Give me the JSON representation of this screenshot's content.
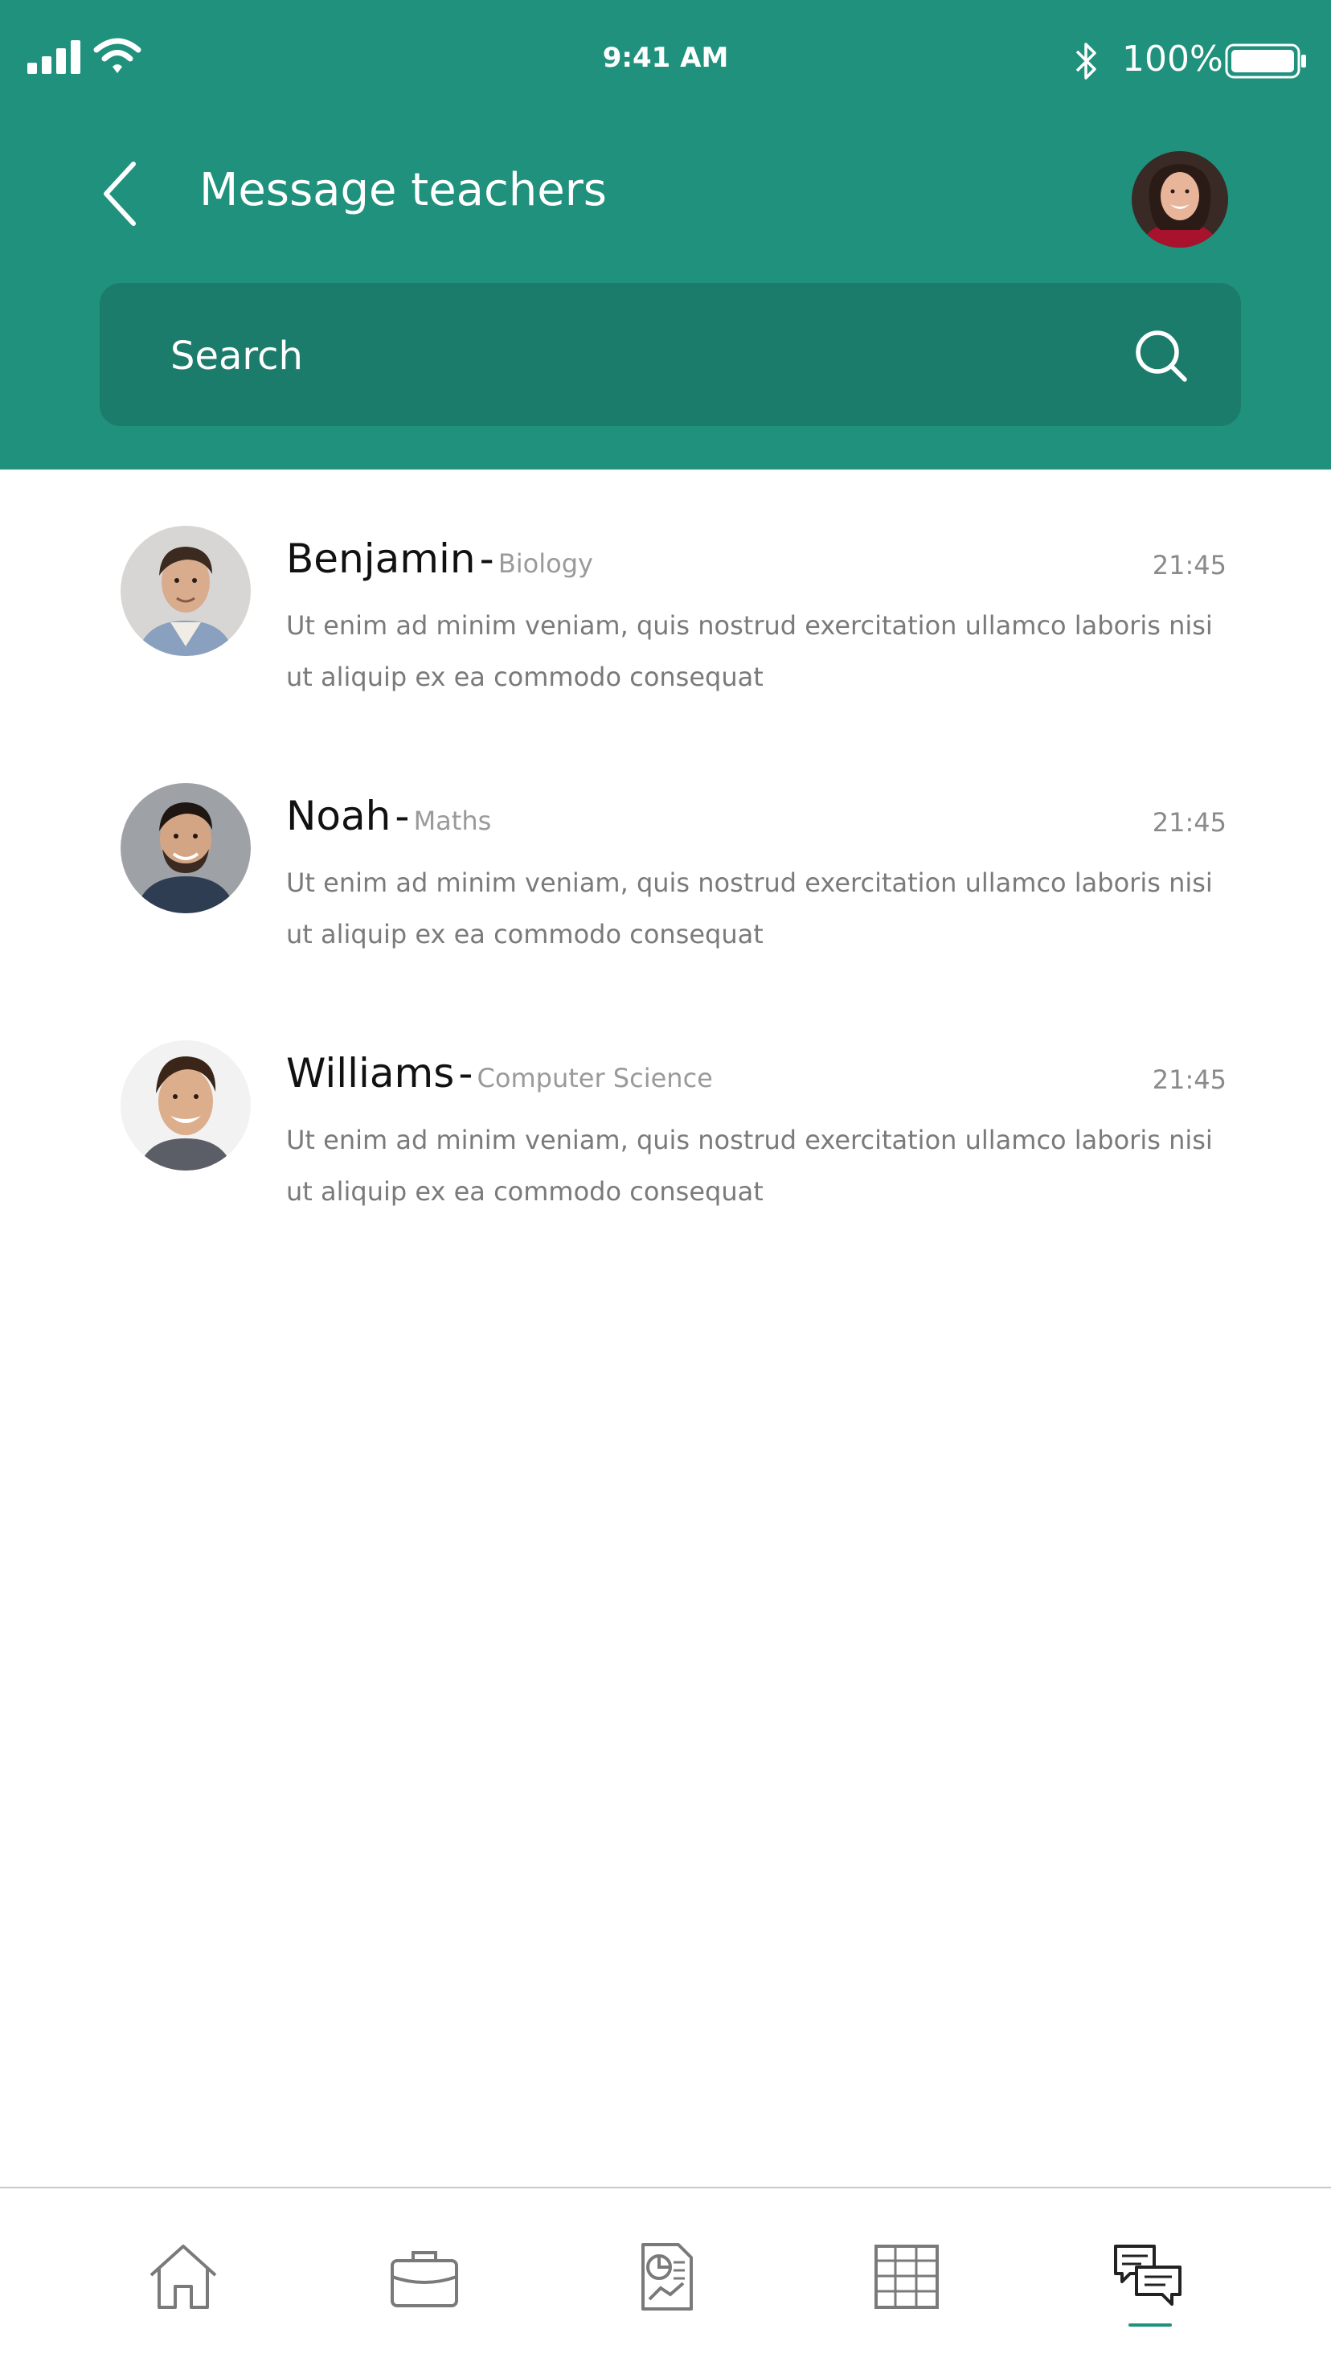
{
  "status_bar": {
    "time": "9:41 AM",
    "battery_percent": "100%",
    "icons": [
      "signal-icon",
      "wifi-icon",
      "bluetooth-icon",
      "battery-icon"
    ]
  },
  "header": {
    "title": "Message teachers",
    "back_icon": "chevron-left-icon",
    "profile_icon": "avatar"
  },
  "search": {
    "placeholder": "Search",
    "icon": "search-icon"
  },
  "conversations": [
    {
      "name": "Benjamin",
      "separator": "-",
      "subject": "Biology",
      "time": "21:45",
      "preview": "Ut enim ad minim veniam, quis nostrud exercitation ullamco laboris nisi ut aliquip ex ea commodo consequat"
    },
    {
      "name": "Noah",
      "separator": "-",
      "subject": "Maths",
      "time": "21:45",
      "preview": "Ut enim ad minim veniam, quis nostrud exercitation ullamco laboris nisi ut aliquip ex ea commodo consequat"
    },
    {
      "name": "Williams",
      "separator": "-",
      "subject": "Computer Science",
      "time": "21:45",
      "preview": "Ut enim ad minim veniam, quis nostrud exercitation ullamco laboris nisi ut aliquip ex ea commodo consequat"
    }
  ],
  "bottom_nav": {
    "items": [
      "home-icon",
      "briefcase-icon",
      "report-icon",
      "timetable-icon",
      "messages-icon"
    ],
    "active": "messages-icon"
  },
  "colors": {
    "primary": "#1f917c",
    "search_bg": "#1b7c6b"
  }
}
